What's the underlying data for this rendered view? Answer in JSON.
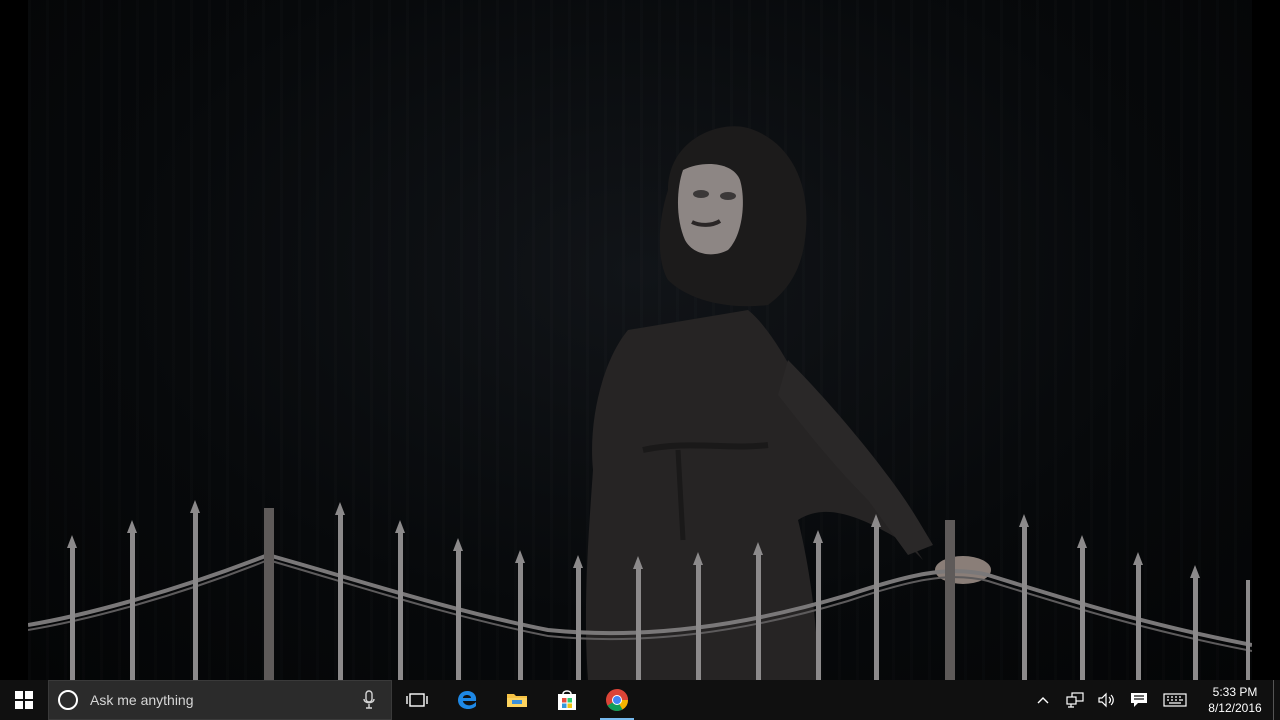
{
  "video": {
    "description_icon": "hooded-figure-scene"
  },
  "taskbar": {
    "search": {
      "placeholder": "Ask me anything"
    },
    "pinned": [
      {
        "name": "task-view-icon"
      },
      {
        "name": "edge-icon"
      },
      {
        "name": "file-explorer-icon"
      },
      {
        "name": "store-icon"
      },
      {
        "name": "chrome-icon"
      }
    ],
    "tray": {
      "time": "5:33 PM",
      "date": "8/12/2016"
    },
    "colors": {
      "background": "#101010",
      "search_bg": "#2b2b2b",
      "accent": "#76b9ed"
    }
  }
}
